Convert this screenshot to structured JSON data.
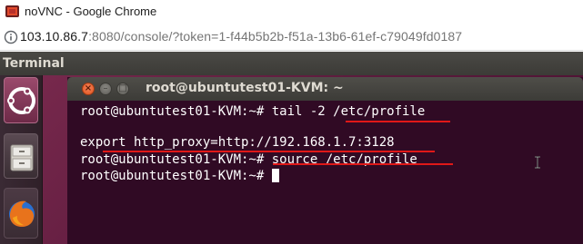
{
  "browser": {
    "window_title": "noVNC - Google Chrome",
    "url_host": "103.10.86.7",
    "url_path": ":8080/console/?token=1-f44b5b2b-f51a-13b6-61ef-c79049fd0187"
  },
  "ubuntu": {
    "panel_title": "Terminal",
    "launcher": [
      "ubuntu-dash-icon",
      "files-icon",
      "firefox-icon"
    ]
  },
  "terminal": {
    "title": "root@ubuntutest01-KVM: ~",
    "window_buttons": {
      "close": "×",
      "minimize": "–",
      "maximize": "□"
    },
    "lines": [
      "root@ubuntutest01-KVM:~# tail -2 /etc/profile",
      "export http_proxy=http://192.168.1.7:3128",
      "root@ubuntutest01-KVM:~# source /etc/profile",
      "root@ubuntutest01-KVM:~# "
    ]
  },
  "colors": {
    "terminal_bg": "#300a24",
    "annotation": "#e01818",
    "panel_bg": "#3c3b37"
  }
}
